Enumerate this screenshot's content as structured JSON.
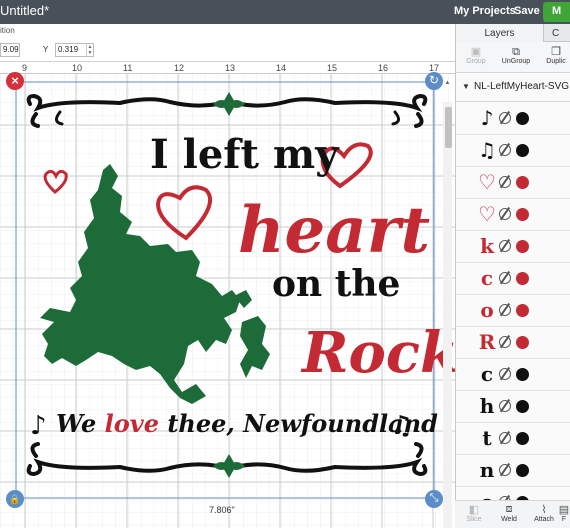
{
  "topbar": {
    "title": "Untitled*",
    "my_projects": "My Projects",
    "save": "Save",
    "make": "M"
  },
  "toolbar": {
    "position_label": "ition",
    "x_value": "9.09",
    "y_label": "Y",
    "y_value": "0.319"
  },
  "ruler": {
    "ticks": [
      "9",
      "10",
      "11",
      "12",
      "13",
      "14",
      "15",
      "16",
      "17"
    ]
  },
  "canvas": {
    "width_readout": "7.806\"",
    "design_text": {
      "line1": "I left my",
      "line2": "heart",
      "line3": "on the",
      "line4": "Rock",
      "line5a": "We ",
      "line5b": "love",
      "line5c": " thee, Newfoundland"
    },
    "colors": {
      "black": "#111111",
      "red": "#c42a33",
      "green": "#1e6b3a",
      "grid": "#d4d7d9",
      "selection": "#5c8dc9"
    }
  },
  "panel": {
    "tab_layers": "Layers",
    "tab_color": "C",
    "actions": {
      "group": "Group",
      "ungroup": "UnGroup",
      "duplicate": "Duplic"
    },
    "group_name": "NL-LeftMyHeart-SVG",
    "layers": [
      {
        "glyph": "♪",
        "kind": "text",
        "color": "#111111"
      },
      {
        "glyph": "♫",
        "kind": "text",
        "color": "#111111"
      },
      {
        "glyph": "♡",
        "kind": "heart",
        "color": "#c42a33"
      },
      {
        "glyph": "♡",
        "kind": "heart",
        "color": "#c42a33"
      },
      {
        "glyph": "k",
        "kind": "text",
        "color": "#c42a33"
      },
      {
        "glyph": "c",
        "kind": "text",
        "color": "#c42a33"
      },
      {
        "glyph": "o",
        "kind": "text",
        "color": "#c42a33"
      },
      {
        "glyph": "R",
        "kind": "text",
        "color": "#c42a33"
      },
      {
        "glyph": "c",
        "kind": "text",
        "color": "#111111"
      },
      {
        "glyph": "h",
        "kind": "text",
        "color": "#111111"
      },
      {
        "glyph": "t",
        "kind": "text",
        "color": "#111111"
      },
      {
        "glyph": "n",
        "kind": "text",
        "color": "#111111"
      },
      {
        "glyph": "o",
        "kind": "text",
        "color": "#111111"
      }
    ],
    "bottom": {
      "slice": "Slice",
      "weld": "Weld",
      "attach": "Attach",
      "flatten": "F"
    }
  }
}
